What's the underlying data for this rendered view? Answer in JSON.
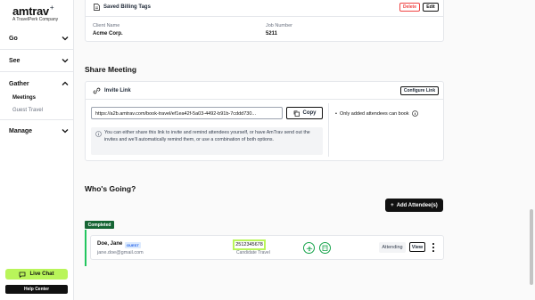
{
  "sidebar": {
    "logo_text": "amtrav",
    "logo_plus": "+",
    "logo_sub": "A TravelPerk Company",
    "sections": [
      {
        "label": "Go"
      },
      {
        "label": "See"
      },
      {
        "label": "Gather"
      },
      {
        "label": "Manage"
      }
    ],
    "gather_items": [
      "Meetings",
      "Guest Travel"
    ],
    "live_chat": "Live Chat",
    "help_center": "Help Center"
  },
  "billing": {
    "title": "Saved Billing Tags",
    "delete_label": "Delete",
    "edit_label": "Edit",
    "client_name_label": "Client Name",
    "client_name_value": "Acme Corp.",
    "job_number_label": "Job Number",
    "job_number_value": "5211"
  },
  "share_meeting": {
    "heading": "Share Meeting",
    "invite_link_label": "Invite Link",
    "configure_link": "Configure Link",
    "url": "https://a2b.amtrav.com/book-travel/ef1ea42f-5a03-4492-b91b-7cddd730...",
    "copy_label": "Copy",
    "info_text": "You can either share this link to invite and remind attendees yourself, or have AmTrav send out the invites and we'll automatically remind them, or use a combination of both options.",
    "only_added": "Only added attendees can book"
  },
  "whos_going": {
    "heading": "Who's Going?",
    "add_button": "Add Attendee(s)",
    "status_badge": "Completed",
    "attendee": {
      "name": "Doe, Jane",
      "badge": "GUEST",
      "email": "jane.doe@gmail.com",
      "confirmation": "2512345678",
      "type": "Candidate Travel",
      "status": "Attending",
      "view_label": "View"
    }
  },
  "colors": {
    "accent_green": "#b9f55a",
    "completed_green": "#166534",
    "delete_red": "#ef4444",
    "guest_blue": "#2563eb"
  }
}
